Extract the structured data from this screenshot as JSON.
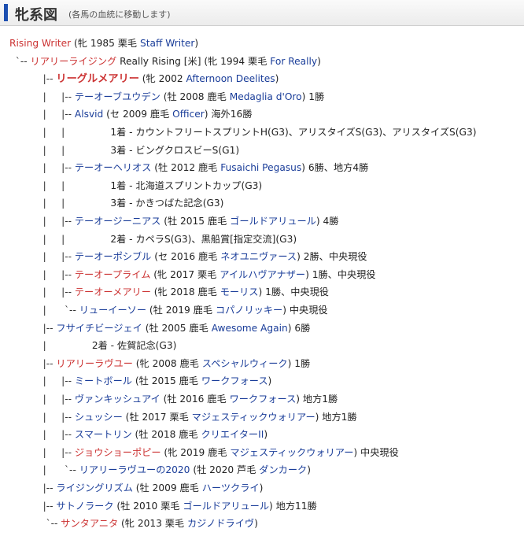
{
  "header": {
    "title": "牝系図",
    "subtitle": "(各馬の血統に移動します)"
  },
  "colors": {
    "link": "#1a3d99",
    "highlight": "#cc3333",
    "header_bar": "#1d4fb0"
  },
  "rows": [
    {
      "prefix": "",
      "parts": [
        {
          "t": "Rising Writer",
          "c": "red",
          "link": true
        },
        {
          "t": " (牝 1985 栗毛 "
        },
        {
          "t": "Staff Writer",
          "c": "en",
          "link": true
        },
        {
          "t": ")"
        }
      ]
    },
    {
      "prefix": "  `-- ",
      "parts": [
        {
          "t": "リアリーライジング",
          "c": "red",
          "link": true
        },
        {
          "t": " Really Rising [米] (牝 1994 栗毛 "
        },
        {
          "t": "For Really",
          "c": "en",
          "link": true
        },
        {
          "t": ")"
        }
      ]
    },
    {
      "prefix": "           |-- ",
      "parts": [
        {
          "t": "リーグルメアリー",
          "c": "red",
          "link": true,
          "bold": true
        },
        {
          "t": " (牝 2002 "
        },
        {
          "t": "Afternoon Deelites",
          "c": "en",
          "link": true
        },
        {
          "t": ")"
        }
      ]
    },
    {
      "prefix": "           |     |-- ",
      "parts": [
        {
          "t": "テーオーブユウデン",
          "c": "ja",
          "link": true
        },
        {
          "t": " (牡 2008 鹿毛 "
        },
        {
          "t": "Medaglia d'Oro",
          "c": "en",
          "link": true
        },
        {
          "t": ") 1勝"
        }
      ]
    },
    {
      "prefix": "           |     |-- ",
      "parts": [
        {
          "t": "Alsvid",
          "c": "en",
          "link": true
        },
        {
          "t": " (セ 2009 鹿毛 "
        },
        {
          "t": "Officer",
          "c": "en",
          "link": true
        },
        {
          "t": ") 海外16勝"
        }
      ]
    },
    {
      "prefix": "           |     |               ",
      "parts": [
        {
          "t": "1着 - カウントフリートスプリントH(G3)、アリスタイズS(G3)、アリスタイズS(G3)"
        }
      ]
    },
    {
      "prefix": "           |     |               ",
      "parts": [
        {
          "t": "3着 - ビングクロスビーS(G1)"
        }
      ]
    },
    {
      "prefix": "           |     |-- ",
      "parts": [
        {
          "t": "テーオーヘリオス",
          "c": "ja",
          "link": true
        },
        {
          "t": " (牡 2012 鹿毛 "
        },
        {
          "t": "Fusaichi Pegasus",
          "c": "en",
          "link": true
        },
        {
          "t": ") 6勝、地方4勝"
        }
      ]
    },
    {
      "prefix": "           |     |               ",
      "parts": [
        {
          "t": "1着 - 北海道スプリントカップ(G3)"
        }
      ]
    },
    {
      "prefix": "           |     |               ",
      "parts": [
        {
          "t": "3着 - かきつばた記念(G3)"
        }
      ]
    },
    {
      "prefix": "           |     |-- ",
      "parts": [
        {
          "t": "テーオージーニアス",
          "c": "ja",
          "link": true
        },
        {
          "t": " (牡 2015 鹿毛 "
        },
        {
          "t": "ゴールドアリュール",
          "c": "ja",
          "link": true
        },
        {
          "t": ") 4勝"
        }
      ]
    },
    {
      "prefix": "           |     |               ",
      "parts": [
        {
          "t": "2着 - カペラS(G3)、黒船賞[指定交流](G3)"
        }
      ]
    },
    {
      "prefix": "           |     |-- ",
      "parts": [
        {
          "t": "テーオーポシブル",
          "c": "ja",
          "link": true
        },
        {
          "t": " (セ 2016 鹿毛 "
        },
        {
          "t": "ネオユニヴァース",
          "c": "ja",
          "link": true
        },
        {
          "t": ") 2勝、中央現役"
        }
      ]
    },
    {
      "prefix": "           |     |-- ",
      "parts": [
        {
          "t": "テーオープライム",
          "c": "red",
          "link": true
        },
        {
          "t": " (牝 2017 栗毛 "
        },
        {
          "t": "アイルハヴアナザー",
          "c": "ja",
          "link": true
        },
        {
          "t": ") 1勝、中央現役"
        }
      ]
    },
    {
      "prefix": "           |     |-- ",
      "parts": [
        {
          "t": "テーオーメアリー",
          "c": "red",
          "link": true
        },
        {
          "t": " (牝 2018 鹿毛 "
        },
        {
          "t": "モーリス",
          "c": "ja",
          "link": true
        },
        {
          "t": ") 1勝、中央現役"
        }
      ]
    },
    {
      "prefix": "           |      `-- ",
      "parts": [
        {
          "t": "リューイーソー",
          "c": "ja",
          "link": true
        },
        {
          "t": " (牡 2019 鹿毛 "
        },
        {
          "t": "コパノリッキー",
          "c": "ja",
          "link": true
        },
        {
          "t": ") 中央現役"
        }
      ]
    },
    {
      "prefix": "           |-- ",
      "parts": [
        {
          "t": "フサイチビージェイ",
          "c": "ja",
          "link": true
        },
        {
          "t": " (牡 2005 鹿毛 "
        },
        {
          "t": "Awesome Again",
          "c": "en",
          "link": true
        },
        {
          "t": ") 6勝"
        }
      ]
    },
    {
      "prefix": "           |               ",
      "parts": [
        {
          "t": "2着 - 佐賀記念(G3)"
        }
      ]
    },
    {
      "prefix": "           |-- ",
      "parts": [
        {
          "t": "リアリーラヴユー",
          "c": "red",
          "link": true
        },
        {
          "t": " (牝 2008 鹿毛 "
        },
        {
          "t": "スペシャルウィーク",
          "c": "ja",
          "link": true
        },
        {
          "t": ") 1勝"
        }
      ]
    },
    {
      "prefix": "           |     |-- ",
      "parts": [
        {
          "t": "ミートボール",
          "c": "ja",
          "link": true
        },
        {
          "t": " (牡 2015 鹿毛 "
        },
        {
          "t": "ワークフォース",
          "c": "ja",
          "link": true
        },
        {
          "t": ")"
        }
      ]
    },
    {
      "prefix": "           |     |-- ",
      "parts": [
        {
          "t": "ヴァンキッシュアイ",
          "c": "ja",
          "link": true
        },
        {
          "t": " (牡 2016 鹿毛 "
        },
        {
          "t": "ワークフォース",
          "c": "ja",
          "link": true
        },
        {
          "t": ") 地方1勝"
        }
      ]
    },
    {
      "prefix": "           |     |-- ",
      "parts": [
        {
          "t": "シュッシー",
          "c": "ja",
          "link": true
        },
        {
          "t": " (牡 2017 栗毛 "
        },
        {
          "t": "マジェスティックウォリアー",
          "c": "ja",
          "link": true
        },
        {
          "t": ") 地方1勝"
        }
      ]
    },
    {
      "prefix": "           |     |-- ",
      "parts": [
        {
          "t": "スマートリン",
          "c": "ja",
          "link": true
        },
        {
          "t": " (牡 2018 鹿毛 "
        },
        {
          "t": "クリエイターII",
          "c": "ja",
          "link": true
        },
        {
          "t": ")"
        }
      ]
    },
    {
      "prefix": "           |     |-- ",
      "parts": [
        {
          "t": "ジョウショーポピー",
          "c": "red",
          "link": true
        },
        {
          "t": " (牝 2019 鹿毛 "
        },
        {
          "t": "マジェスティックウォリアー",
          "c": "ja",
          "link": true
        },
        {
          "t": ") 中央現役"
        }
      ]
    },
    {
      "prefix": "           |      `-- ",
      "parts": [
        {
          "t": "リアリーラヴユーの2020",
          "c": "ja",
          "link": true
        },
        {
          "t": " (牡 2020 芦毛 "
        },
        {
          "t": "ダンカーク",
          "c": "ja",
          "link": true
        },
        {
          "t": ")"
        }
      ]
    },
    {
      "prefix": "           |-- ",
      "parts": [
        {
          "t": "ライジングリズム",
          "c": "ja",
          "link": true
        },
        {
          "t": " (牡 2009 鹿毛 "
        },
        {
          "t": "ハーツクライ",
          "c": "ja",
          "link": true
        },
        {
          "t": ")"
        }
      ]
    },
    {
      "prefix": "           |-- ",
      "parts": [
        {
          "t": "サトノラーク",
          "c": "ja",
          "link": true
        },
        {
          "t": " (牡 2010 栗毛 "
        },
        {
          "t": "ゴールドアリュール",
          "c": "ja",
          "link": true
        },
        {
          "t": ") 地方11勝"
        }
      ]
    },
    {
      "prefix": "            `-- ",
      "parts": [
        {
          "t": "サンタアニタ",
          "c": "red",
          "link": true
        },
        {
          "t": " (牝 2013 栗毛 "
        },
        {
          "t": "カジノドライヴ",
          "c": "ja",
          "link": true
        },
        {
          "t": ")"
        }
      ]
    }
  ]
}
